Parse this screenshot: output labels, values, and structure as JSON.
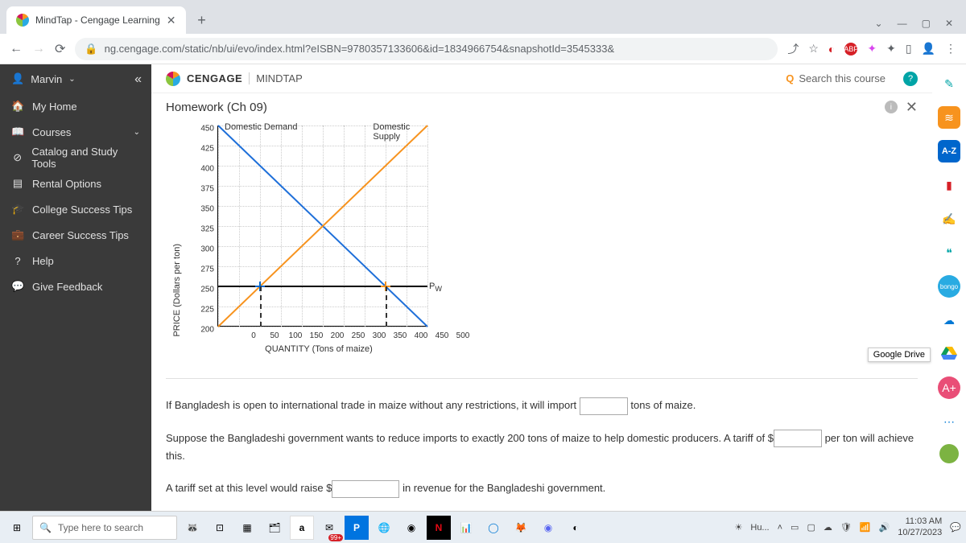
{
  "browser": {
    "tab_title": "MindTap - Cengage Learning",
    "url": "ng.cengage.com/static/nb/ui/evo/index.html?eISBN=9780357133606&id=1834966754&snapshotId=3545333&"
  },
  "brand": {
    "name": "CENGAGE",
    "product": "MINDTAP",
    "search": "Search this course"
  },
  "user": "Marvin",
  "sidebar": {
    "items": [
      {
        "icon": "🏠",
        "label": "My Home"
      },
      {
        "icon": "📖",
        "label": "Courses",
        "expandable": true
      },
      {
        "icon": "⊘",
        "label": "Catalog and Study Tools"
      },
      {
        "icon": "▤",
        "label": "Rental Options"
      },
      {
        "icon": "🎓",
        "label": "College Success Tips"
      },
      {
        "icon": "💼",
        "label": "Career Success Tips"
      },
      {
        "icon": "?",
        "label": "Help"
      },
      {
        "icon": "💬",
        "label": "Give Feedback"
      }
    ]
  },
  "assignment": "Homework (Ch 09)",
  "chart_data": {
    "type": "line",
    "xlabel": "QUANTITY (Tons of maize)",
    "ylabel": "PRICE (Dollars per ton)",
    "xlim": [
      0,
      500
    ],
    "ylim": [
      200,
      450
    ],
    "xticks": [
      0,
      50,
      100,
      150,
      200,
      250,
      300,
      350,
      400,
      450,
      500
    ],
    "yticks": [
      200,
      225,
      250,
      275,
      300,
      325,
      350,
      375,
      400,
      425,
      450
    ],
    "series": [
      {
        "name": "Domestic Demand",
        "color": "#1e6fd9",
        "points": [
          [
            0,
            450
          ],
          [
            500,
            200
          ]
        ]
      },
      {
        "name": "Domestic Supply",
        "color": "#f7931e",
        "points": [
          [
            0,
            200
          ],
          [
            500,
            450
          ]
        ]
      },
      {
        "name": "Pw",
        "color": "#000",
        "points": [
          [
            0,
            250
          ],
          [
            500,
            250
          ]
        ],
        "label_at": [
          500,
          250
        ]
      }
    ],
    "markers": [
      {
        "x": 100,
        "y": 250,
        "style": "blue-plus",
        "drop_to_x": true
      },
      {
        "x": 400,
        "y": 250,
        "style": "orange-plus",
        "drop_to_x": true
      }
    ]
  },
  "question": {
    "q1_pre": "If Bangladesh is open to international trade in maize without any restrictions, it will import",
    "q1_post": "tons of maize.",
    "q2_pre": "Suppose the Bangladeshi government wants to reduce imports to exactly 200 tons of maize to help domestic producers. A tariff of",
    "q2_mid": "$",
    "q2_post": "per ton will achieve this.",
    "q3_pre": "A tariff set at this level would raise",
    "q3_mid": "$",
    "q3_post": "in revenue for the Bangladeshi government."
  },
  "rail_gd": "Google Drive",
  "taskbar": {
    "search_placeholder": "Type here to search",
    "badge": "99+",
    "weather": "Hu...",
    "time": "11:03 AM",
    "date": "10/27/2023"
  }
}
